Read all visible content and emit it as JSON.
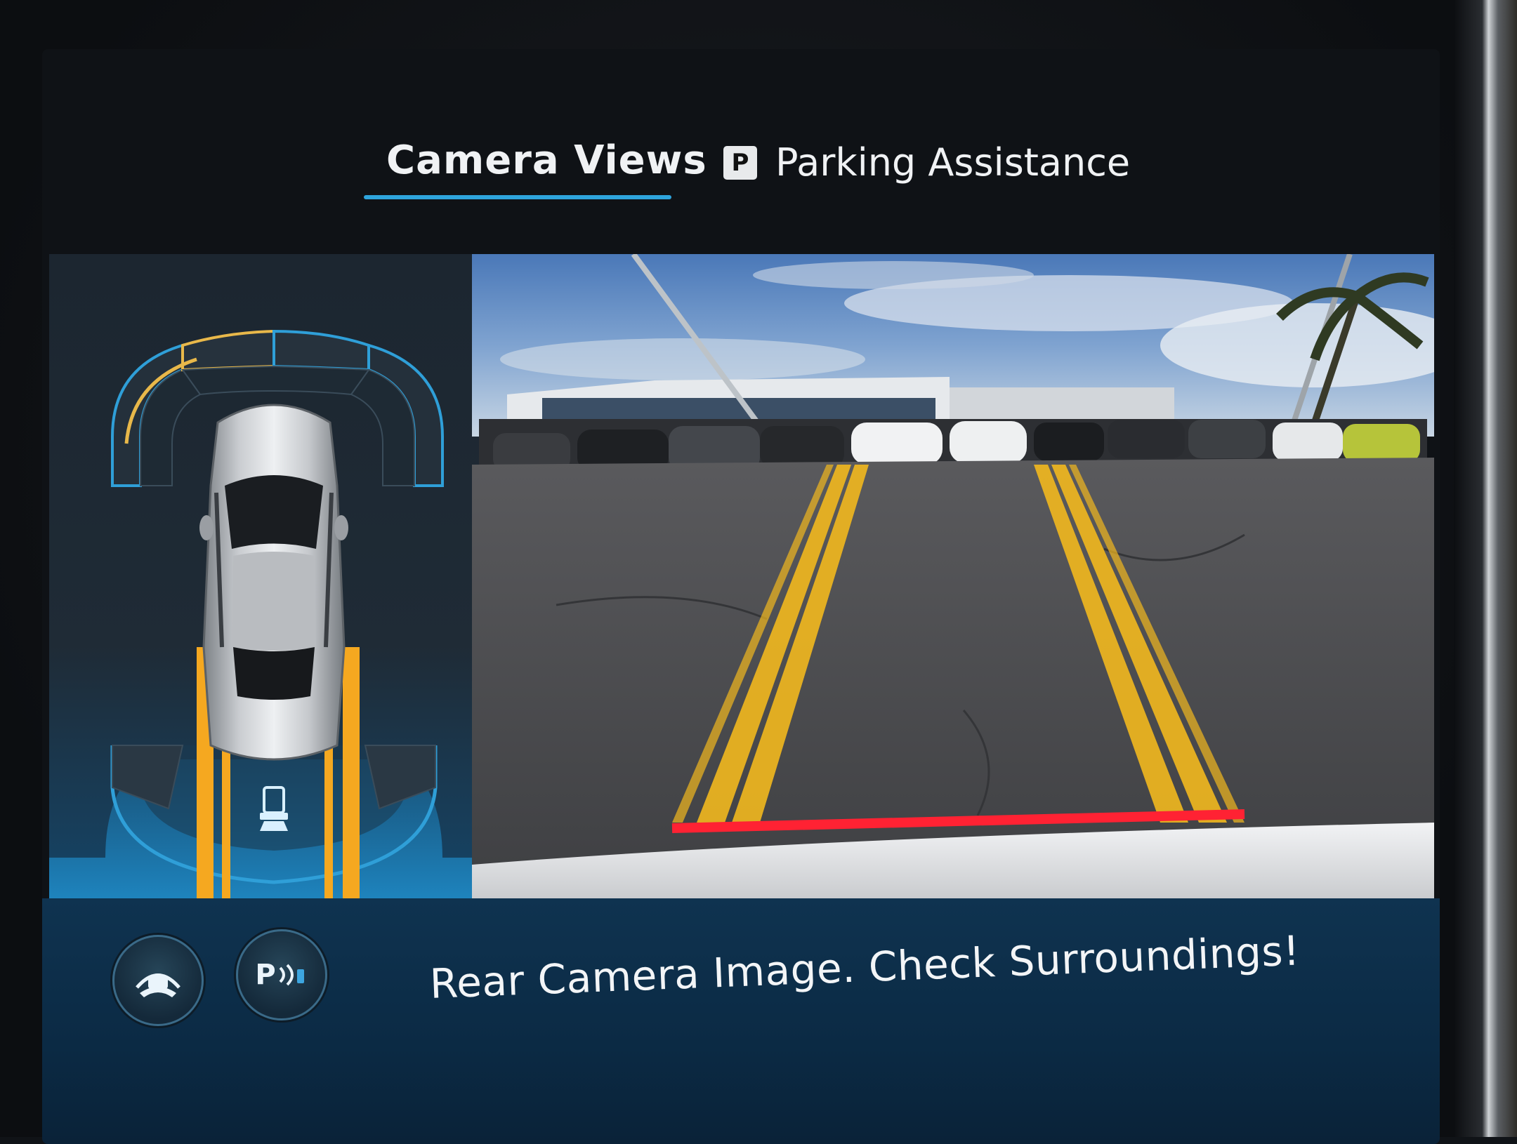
{
  "tabs": [
    {
      "label": "Camera Views",
      "active": true
    },
    {
      "label": "Parking Assistance",
      "active": false,
      "badge": "P"
    }
  ],
  "status": {
    "message": "Rear Camera Image. Check Surroundings!"
  },
  "buttons": {
    "parktronic_label": "P",
    "parktronic_icon": "parking-sensor-icon",
    "view_icon": "camera-view-toggle-icon"
  },
  "camera": {
    "view": "rear",
    "guide_line_color": "#f2b81e",
    "stop_line_color": "#ff2233"
  },
  "sensors": {
    "front_left_warning_color": "#e8b84a",
    "arc_color": "#2f9fd8",
    "rear_zone_color": "#1f8ac6",
    "path_color": "#f5a820"
  }
}
